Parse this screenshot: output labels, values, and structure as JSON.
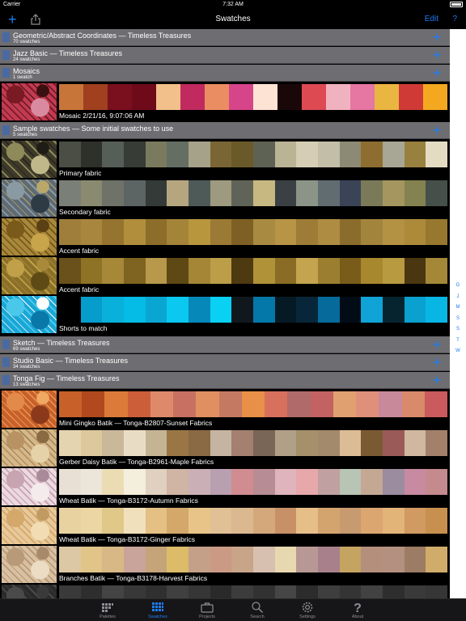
{
  "status_bar": {
    "carrier": "Carrier",
    "time": "7:32 AM"
  },
  "nav": {
    "title": "Swatches",
    "edit_label": "Edit",
    "help_label": "?"
  },
  "sections": [
    {
      "title": "Geometric/Abstract Coordinates — Timeless Treasures",
      "subtitle": "70 swatches"
    },
    {
      "title": "Jazz Basic — Timeless Treasures",
      "subtitle": "24 swatches"
    },
    {
      "title": "Mosaics",
      "subtitle": "1 swatch"
    },
    {
      "title": "Sample swatches — Some initial swatches to use",
      "subtitle": "5 swatches"
    },
    {
      "title": "Sketch — Timeless Treasures",
      "subtitle": "69 swatches"
    },
    {
      "title": "Studio Basic — Timeless Treasures",
      "subtitle": "34 swatches"
    },
    {
      "title": "Tonga Fig — Timeless Treasures",
      "subtitle": "13 swatches"
    }
  ],
  "rows": [
    {
      "label": "Mosaic 2/21/16, 9:07:06 AM",
      "thumb": [
        "#c23a52",
        "#7a1a22",
        "#d98aa0",
        "#3a1010"
      ],
      "colors": [
        "#c8753a",
        "#a0401e",
        "#7a0f1e",
        "#6e0a1a",
        "#f2c08a",
        "#c02a5e",
        "#ea8d62",
        "#d6448a",
        "#fde3d4",
        "#1a0808",
        "#de4a52",
        "#f1b2c0",
        "#e676a2",
        "#eab642",
        "#d03a36",
        "#f4a820"
      ]
    },
    {
      "label": "Primary fabric",
      "thumb": [
        "#3e3a2a",
        "#8e8a5a",
        "#c0b88a",
        "#1e1c14"
      ],
      "colors": [
        "#4a4e44",
        "#2e302a",
        "#565e58",
        "#373c36",
        "#7a7a5e",
        "#646e62",
        "#a6a28a",
        "#7a6634",
        "#6a5a2a",
        "#5e6254",
        "#bab394",
        "#d6ceb4",
        "#c2bea8",
        "#8c8a74",
        "#8e6e30",
        "#a8a694",
        "#98803e",
        "#e4dcc2"
      ]
    },
    {
      "label": "Secondary fabric",
      "thumb": [
        "#5e6a74",
        "#8a9aa2",
        "#2e3a44",
        "#b8a86a"
      ],
      "colors": [
        "#7a8078",
        "#8a8a70",
        "#6e7268",
        "#5c6464",
        "#343a38",
        "#b6a680",
        "#4e5a58",
        "#9e9a80",
        "#606458",
        "#c6b880",
        "#3a4044",
        "#8c9488",
        "#606c70",
        "#3a4456",
        "#7a7a58",
        "#a4965e",
        "#848250",
        "#46504a"
      ]
    },
    {
      "label": "Accent fabric",
      "thumb": [
        "#a8883a",
        "#7a5a1a",
        "#c8a44a",
        "#5a4012"
      ],
      "colors": [
        "#9e7e3a",
        "#a8863e",
        "#94742e",
        "#b08e3c",
        "#8c6e2a",
        "#a48438",
        "#b8963e",
        "#9a7a34",
        "#7e6024",
        "#a88a40",
        "#b89446",
        "#9c7c36",
        "#ae8c42",
        "#8a6c2c",
        "#a2843c",
        "#b49244",
        "#ac8a3a",
        "#98782e"
      ]
    },
    {
      "label": "Accent fabric",
      "thumb": [
        "#8a7028",
        "#c0a048",
        "#5e4a14",
        "#a88a3a"
      ],
      "colors": [
        "#6a501a",
        "#8e7226",
        "#a68838",
        "#7e6420",
        "#b8984a",
        "#5e4814",
        "#a48636",
        "#bc9e48",
        "#4e3a10",
        "#b09238",
        "#8a6c24",
        "#c4a44e",
        "#9c7e30",
        "#7a5c1a",
        "#a8882e",
        "#b89a40",
        "#4a3610",
        "#a48838"
      ]
    },
    {
      "label": "Shorts to match",
      "thumb": [
        "#1aa6d6",
        "#4ac8ea",
        "#0a78a8",
        "#ffffff"
      ],
      "colors": [
        "#000000",
        "#069ccc",
        "#08b0da",
        "#04bce6",
        "#0aa6d2",
        "#0ac8f0",
        "#0688b8",
        "#0ad0f4",
        "#10181e",
        "#0478a8",
        "#061a26",
        "#08263a",
        "#066a9a",
        "#020c16",
        "#10a4d6",
        "#062430",
        "#0aa0d0",
        "#08b6e4"
      ]
    },
    {
      "label": "Mini Gingko Batik — Tonga-B2807-Sunset Fabrics",
      "thumb": [
        "#c8602a",
        "#e28a4a",
        "#8a3a1a",
        "#f0a862"
      ],
      "colors": [
        "#c8602a",
        "#b04a1e",
        "#dc7a3a",
        "#cc5e3a",
        "#de8a6a",
        "#c87062",
        "#e09060",
        "#c47a62",
        "#e89048",
        "#d8705e",
        "#b06a6a",
        "#c26262",
        "#e0a070",
        "#e0907a",
        "#c88a9a",
        "#d88a6a",
        "#ca5a5e"
      ]
    },
    {
      "label": "Gerber Daisy Batik — Tonga-B2961-Maple Fabrics",
      "thumb": [
        "#d4b88a",
        "#b89262",
        "#e6d2a8",
        "#8a6a42"
      ],
      "colors": [
        "#e4d4b0",
        "#dcc89a",
        "#cab89a",
        "#e8dcc4",
        "#c4b494",
        "#9a7644",
        "#8a6a44",
        "#c6b4a2",
        "#a48070",
        "#7a6656",
        "#b0a088",
        "#a4906a",
        "#a48a6c",
        "#dcbc94",
        "#7a5a32",
        "#9a5a58",
        "#d0b8a0",
        "#a2806a"
      ]
    },
    {
      "label": "Wheat Batik — Tonga-B3172-Autumn Fabrics",
      "thumb": [
        "#ecd8e0",
        "#c8a4b0",
        "#f4ecec",
        "#a88a98"
      ],
      "colors": [
        "#e8e0d4",
        "#ece6da",
        "#ecdcb4",
        "#f4eedc",
        "#e0d0c0",
        "#d0b4a4",
        "#cab0b6",
        "#b8a0b0",
        "#d08c90",
        "#b88c94",
        "#e0b4bc",
        "#e6a8aa",
        "#c0a0a0",
        "#b8c4b4",
        "#c4a894",
        "#9c8ca0",
        "#c88aa0",
        "#c48a8e"
      ]
    },
    {
      "label": "Wheat Batik — Tonga-B3172-Ginger Fabrics",
      "thumb": [
        "#e8c898",
        "#d4a86a",
        "#f2dcb4",
        "#c09a62"
      ],
      "colors": [
        "#e8d2a0",
        "#ecd6a4",
        "#e0c888",
        "#f0e0bc",
        "#e4c084",
        "#d4a86a",
        "#e8c488",
        "#e0c094",
        "#dcb890",
        "#d4a87a",
        "#c89066",
        "#e6be88",
        "#d4a46e",
        "#c89a70",
        "#dca670",
        "#e2b478",
        "#d09a62",
        "#c8904e"
      ]
    },
    {
      "label": "Branches Batik — Tonga-B3178-Harvest Fabrics",
      "thumb": [
        "#d8c0a0",
        "#b89a78",
        "#ecdcc4",
        "#a88a6a"
      ],
      "colors": [
        "#dcc8a4",
        "#e0c488",
        "#d8b884",
        "#c8a49a",
        "#c4a478",
        "#dcbc68",
        "#c4a088",
        "#ca9a84",
        "#c8a488",
        "#d8c0b0",
        "#e8d8b0",
        "#b89894",
        "#a8808c",
        "#c4a460",
        "#b4907c",
        "#b49080",
        "#9c7c64",
        "#d0ac6a"
      ]
    },
    {
      "label": "",
      "thumb": [
        "#2a2a2a",
        "#4a4a4a",
        "#1a1a1a",
        "#3a3a3a"
      ],
      "colors": [
        "#3a3a3a",
        "#2e2e2e",
        "#444444",
        "#383838",
        "#303030",
        "#404040",
        "#363636",
        "#2a2a2a",
        "#3c3c3c",
        "#323232",
        "#464646",
        "#2c2c2c",
        "#3e3e3e",
        "#343434",
        "#424242",
        "#2e2e2e",
        "#3a3a3a",
        "#363636"
      ]
    }
  ],
  "index_letters": [
    "G",
    "J",
    "M",
    "S",
    "S",
    "T",
    "W"
  ],
  "tabs": [
    {
      "label": "Palettes",
      "icon": "palettes-icon"
    },
    {
      "label": "Swatches",
      "icon": "swatches-icon"
    },
    {
      "label": "Projects",
      "icon": "briefcase-icon"
    },
    {
      "label": "Search",
      "icon": "search-icon"
    },
    {
      "label": "Settings",
      "icon": "gear-icon"
    },
    {
      "label": "About",
      "icon": "question-icon"
    }
  ],
  "colors": {
    "accent": "#1e7cf2",
    "section_bg": "#6e6e72",
    "tab_bar_bg": "#161618",
    "inactive_tab": "#8e8e93"
  }
}
